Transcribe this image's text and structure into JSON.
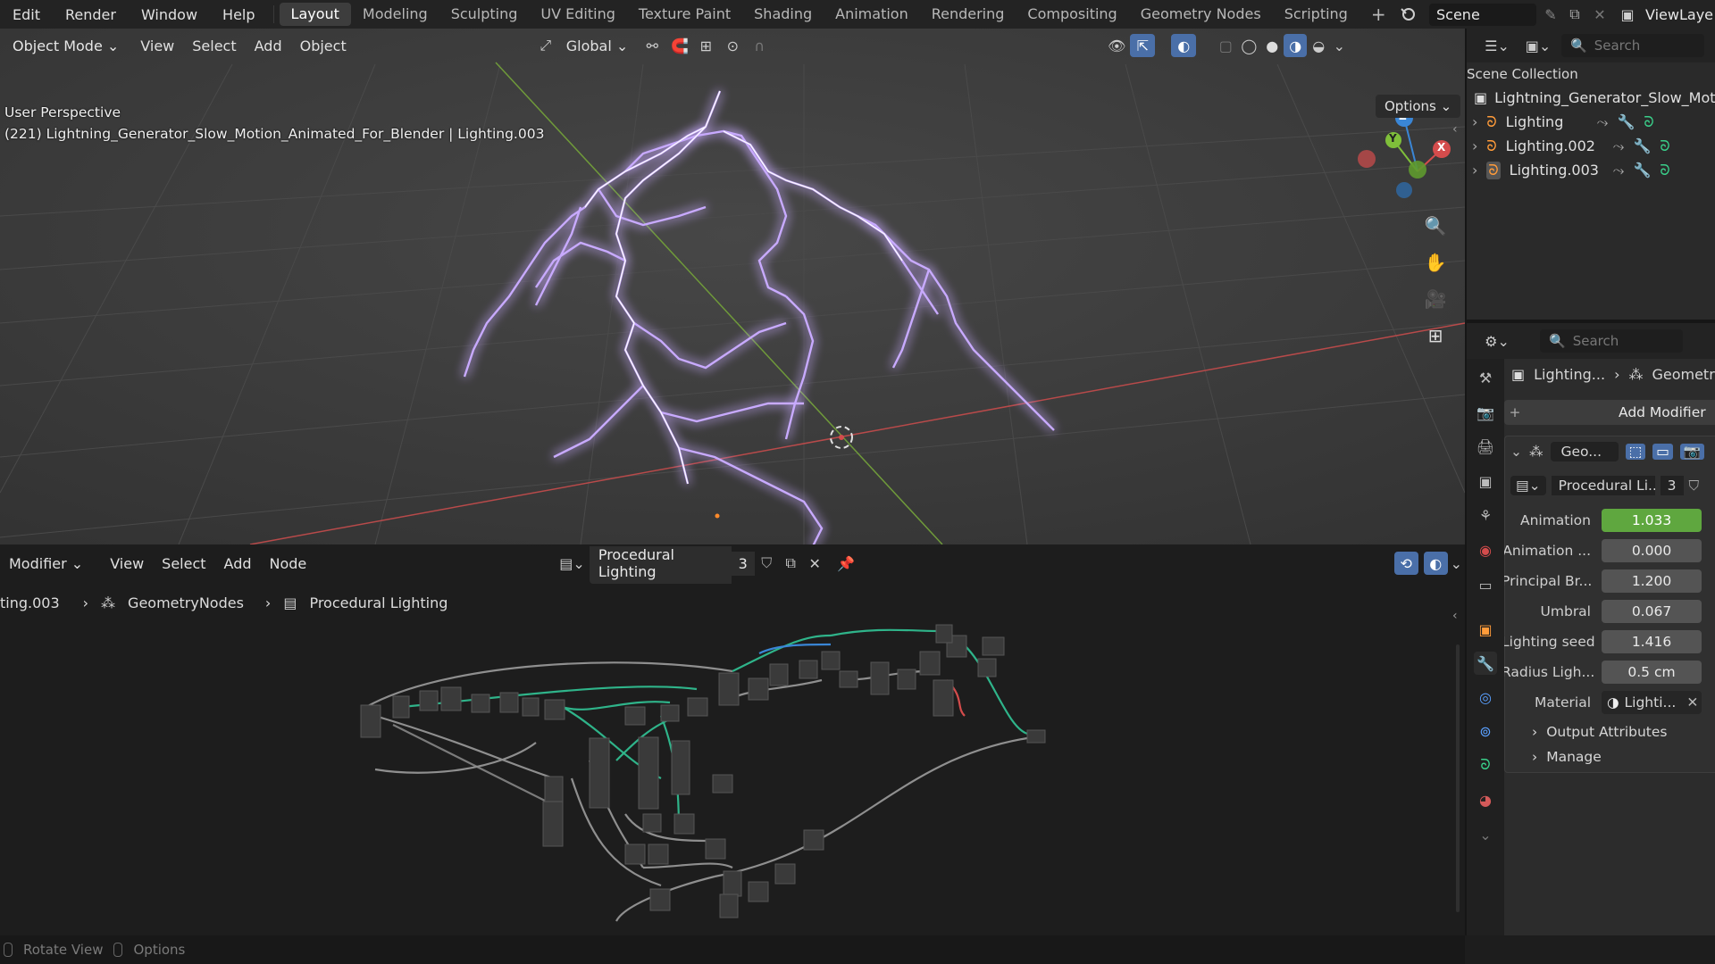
{
  "topbar": {
    "menus": [
      "Edit",
      "Render",
      "Window",
      "Help"
    ],
    "workspaces": [
      "Layout",
      "Modeling",
      "Sculpting",
      "UV Editing",
      "Texture Paint",
      "Shading",
      "Animation",
      "Rendering",
      "Compositing",
      "Geometry Nodes",
      "Scripting"
    ],
    "active_workspace": "Layout",
    "add_workspace": "+",
    "scene_name": "Scene",
    "view_layer": "ViewLaye"
  },
  "viewport": {
    "mode": "Object Mode",
    "menus": [
      "View",
      "Select",
      "Add",
      "Object"
    ],
    "transform_orientation": "Global",
    "options_label": "Options",
    "perspective_label": "User Perspective",
    "object_info": "(221) Lightning_Generator_Slow_Motion_Animated_For_Blender | Lighting.003",
    "gizmo_axes": {
      "x": "X",
      "y": "Y",
      "z": "Z"
    },
    "colors": {
      "x_axis": "#d44c4c",
      "y_axis": "#7fbf3a",
      "z_axis": "#3a86d6",
      "bolt": "#b58cff"
    }
  },
  "node_editor": {
    "mode": "Modifier",
    "menus": [
      "View",
      "Select",
      "Add",
      "Node"
    ],
    "node_tree_name": "Procedural Lighting",
    "users": "3",
    "breadcrumb": [
      "ting.003",
      "GeometryNodes",
      "Procedural Lighting"
    ]
  },
  "status_bar": {
    "items": [
      "Rotate View",
      "Options"
    ]
  },
  "outliner": {
    "search_placeholder": "Search",
    "scene_collection": "Scene Collection",
    "collection_name": "Lightning_Generator_Slow_Motion_",
    "items": [
      {
        "name": "Lighting"
      },
      {
        "name": "Lighting.002"
      },
      {
        "name": "Lighting.003"
      }
    ]
  },
  "properties": {
    "search_placeholder": "Search",
    "breadcrumb_object": "Lighting...",
    "breadcrumb_modifier": "Geometr",
    "add_modifier_label": "Add Modifier",
    "modifier_name": "Geo...",
    "node_group_name": "Procedural Li...",
    "node_group_users": "3",
    "inputs": [
      {
        "label": "Animation",
        "value": "1.033",
        "highlight": true
      },
      {
        "label": "Animation ...",
        "value": "0.000"
      },
      {
        "label": "Principal Br...",
        "value": "1.200"
      },
      {
        "label": "Umbral",
        "value": "0.067"
      },
      {
        "label": "Lighting seed",
        "value": "1.416"
      },
      {
        "label": "Radius Ligh...",
        "value": "0.5 cm"
      }
    ],
    "material_label": "Material",
    "material_value": "Lighti...",
    "panels": [
      "Output Attributes",
      "Manage"
    ]
  }
}
